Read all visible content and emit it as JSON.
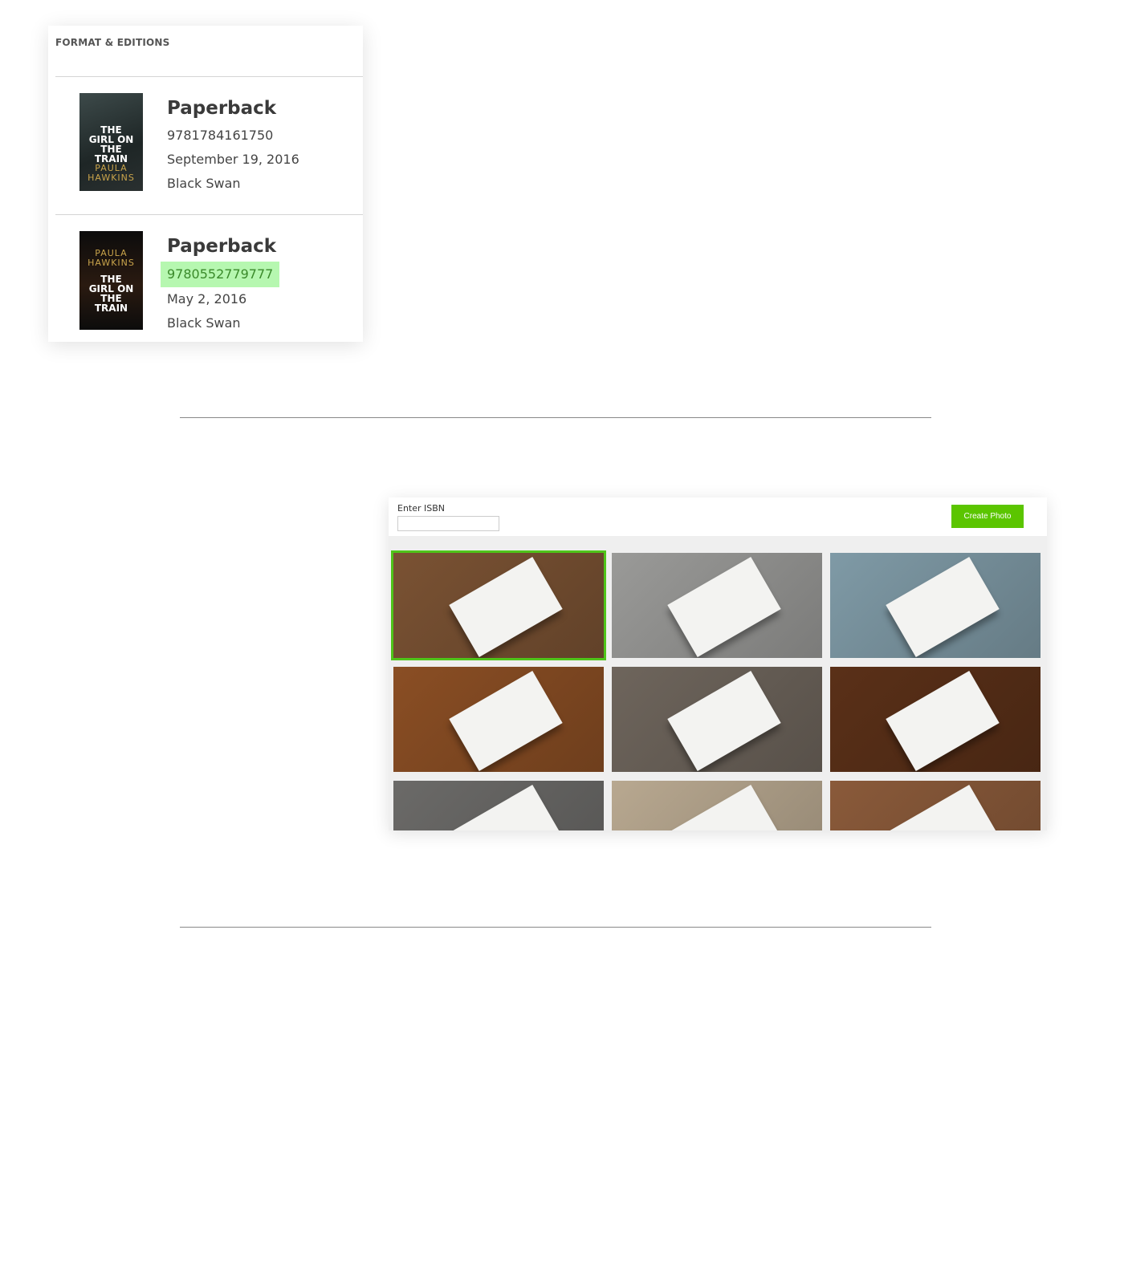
{
  "format_card": {
    "title": "FORMAT & EDITIONS",
    "editions": [
      {
        "format": "Paperback",
        "isbn": "9781784161750",
        "date": "September 19, 2016",
        "publisher": "Black Swan",
        "highlighted": false,
        "cover": {
          "top": "THE GIRL ON THE TRAIN",
          "author": "PAULA HAWKINS"
        }
      },
      {
        "format": "Paperback",
        "isbn": "9780552779777",
        "date": "May 2, 2016",
        "publisher": "Black Swan",
        "highlighted": true,
        "cover": {
          "top": "THE GIRL ON THE TRAIN",
          "author": "PAULA HAWKINS"
        }
      }
    ],
    "highlight_color": "#b6f7b0"
  },
  "photo_tool": {
    "isbn_label": "Enter ISBN",
    "isbn_value": "",
    "create_button": "Create Photo",
    "accent": "#5bc500",
    "selected_index": 0,
    "photos": [
      {
        "scene": "cafe-table-orange-cups",
        "bg": "#7a5233"
      },
      {
        "scene": "lap-backpack",
        "bg": "#9a9a98"
      },
      {
        "scene": "blue-painted-wood-plant",
        "bg": "#7f9aa6"
      },
      {
        "scene": "wooden-table",
        "bg": "#8a4e24"
      },
      {
        "scene": "weathered-plank",
        "bg": "#6e655c"
      },
      {
        "scene": "dark-wood-teacup",
        "bg": "#5a3018"
      },
      {
        "scene": "tiled-table-coffee",
        "bg": "#6b6a68"
      },
      {
        "scene": "table-salt-pepper",
        "bg": "#b8a890"
      },
      {
        "scene": "table-plant-jars",
        "bg": "#8a5a3a"
      }
    ]
  }
}
